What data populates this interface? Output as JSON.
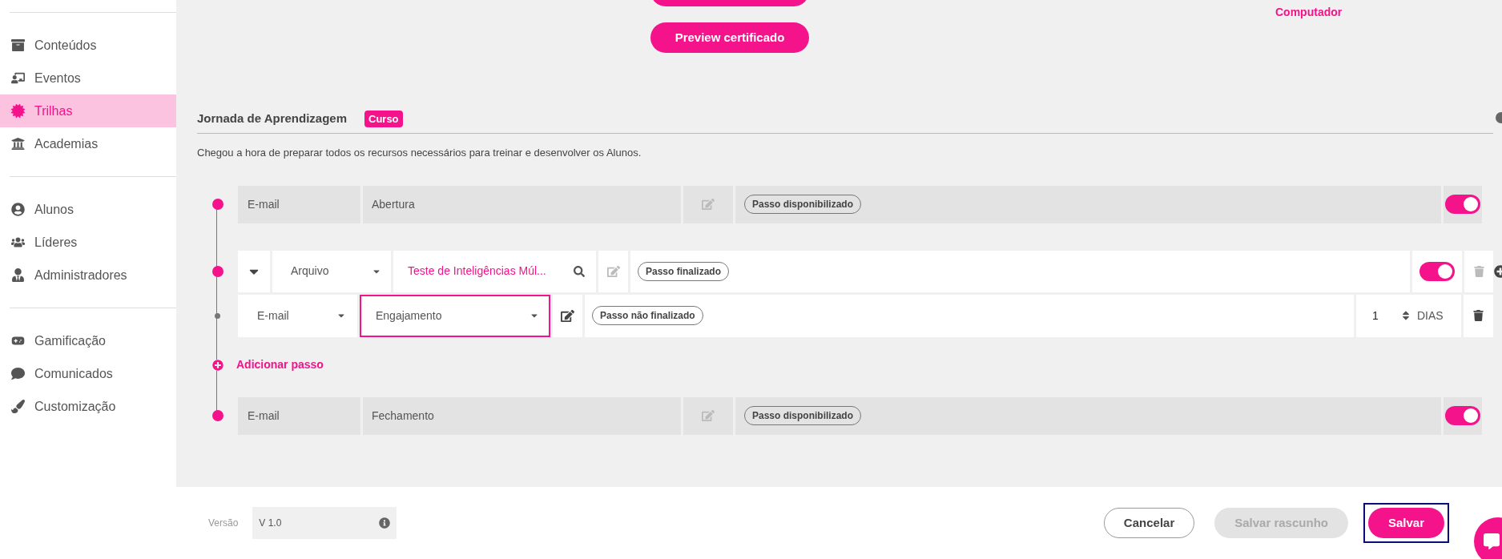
{
  "sidebar": {
    "groups": [
      {
        "items": [
          {
            "label": "Conteúdos",
            "selected": false
          },
          {
            "label": "Eventos",
            "selected": false
          },
          {
            "label": "Trilhas",
            "selected": true
          },
          {
            "label": "Academias",
            "selected": false
          }
        ]
      },
      {
        "items": [
          {
            "label": "Alunos",
            "selected": false
          },
          {
            "label": "Líderes",
            "selected": false
          },
          {
            "label": "Administradores",
            "selected": false
          }
        ]
      },
      {
        "items": [
          {
            "label": "Gamificação",
            "selected": false
          },
          {
            "label": "Comunicados",
            "selected": false
          },
          {
            "label": "Customização",
            "selected": false
          }
        ]
      }
    ]
  },
  "top": {
    "preview_button": "Preview certificado",
    "upload_link": "Computador"
  },
  "section": {
    "title": "Jornada de Aprendizagem",
    "badge": "Curso",
    "description": "Chegou a hora de preparar todos os recursos necessários para treinar e desenvolver os Alunos."
  },
  "steps": [
    {
      "kind": "fixed",
      "type": "E-mail",
      "name": "Abertura",
      "status": "Passo disponibilizado",
      "on": true
    },
    {
      "kind": "group",
      "expanded": true,
      "type": "Arquivo",
      "content": "Teste de Inteligências Múl...",
      "status": "Passo finalizado",
      "on": true,
      "children": [
        {
          "type": "E-mail",
          "template": "Engajamento",
          "focused": true,
          "status": "Passo não finalizado",
          "delay": "1",
          "unit": "DIAS"
        }
      ]
    },
    {
      "kind": "add",
      "label": "Adicionar passo"
    },
    {
      "kind": "fixed",
      "type": "E-mail",
      "name": "Fechamento",
      "status": "Passo disponibilizado",
      "on": true
    }
  ],
  "footer": {
    "version_label": "Versão",
    "version": "V 1.0",
    "buttons": [
      {
        "label": "Cancelar",
        "kind": "outline",
        "disabled": false,
        "focused": false
      },
      {
        "label": "Salvar rascunho",
        "kind": "solid",
        "disabled": true,
        "focused": false
      },
      {
        "label": "Salvar",
        "kind": "solid",
        "disabled": false,
        "focused": true
      }
    ]
  }
}
